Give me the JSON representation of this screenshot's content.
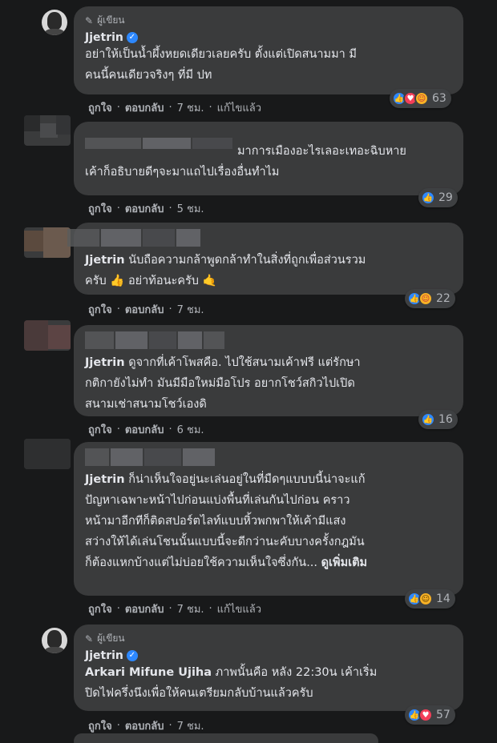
{
  "comments": [
    {
      "is_author": true,
      "author_badge": "ผู้เขียน",
      "name": "Jjetrin",
      "lines": [
        "อย่าให้เป็นน้ำผึ้งหยดเดียวเลยครับ ตั้งแต่เปิดสนามมา มี",
        "คนนี้คนเดียวจริงๆ ที่มี ปท"
      ],
      "actions": {
        "like": "ถูกใจ",
        "reply": "ตอบกลับ",
        "time": "7 ชม.",
        "edited": "แก้ไขแล้ว"
      },
      "reactions": [
        "like-icon",
        "love-icon",
        "care-icon"
      ],
      "reaction_count": "63"
    },
    {
      "is_author": false,
      "lines": [
        "มาการเมืองอะไรเลอะเทอะฉิบหาย",
        "เค้าก็อธิบายดีๆจะมาแถไปเรื่องอื่นทำไม"
      ],
      "actions": {
        "like": "ถูกใจ",
        "reply": "ตอบกลับ",
        "time": "5 ชม."
      },
      "reactions": [
        "like-icon"
      ],
      "reaction_count": "29"
    },
    {
      "is_author": false,
      "mention": "Jjetrin",
      "lines": [
        "นับถือความกล้าพูดกล้าทำในสิ่งที่ถูกเพื่อส่วนรวม",
        "ครับ 👍 อย่าท้อนะครับ 🤙"
      ],
      "actions": {
        "like": "ถูกใจ",
        "reply": "ตอบกลับ",
        "time": "7 ชม."
      },
      "reactions": [
        "like-icon",
        "care-icon"
      ],
      "reaction_count": "22"
    },
    {
      "is_author": false,
      "mention": "Jjetrin",
      "lines": [
        "ดูจากที่เค้าโพสคือ. ไปใช้สนามเค้าฟรี แต่รักษา",
        "กติกายังไม่ทำ มันมีมือใหม่มือโปร อยากโชว์สกิวไปเปิด",
        "สนามเช่าสนามโชว์เองดิ"
      ],
      "actions": {
        "like": "ถูกใจ",
        "reply": "ตอบกลับ",
        "time": "6 ชม."
      },
      "reactions": [
        "like-icon"
      ],
      "reaction_count": "16"
    },
    {
      "is_author": false,
      "mention": "Jjetrin",
      "lines": [
        "ก็น่าเห็นใจอยู่นะเล่นอยู่ในที่มืดๆแบบบนี้น่าจะแก้",
        "ปัญหาเฉพาะหน้าไปก่อนแบ่งพื้นที่เล่นกันไปก่อน คราว",
        "หน้ามาอีกทีก็ติดสปอร์ตไลท์แบบหิ้วพกพาให้เค้ามีแสง",
        "สว่างให้ได้เล่นโชนนั้นแบบนี้จะดีกว่านะคับบางครั้งกฎมัน",
        "ก็ต้องแหกบ้างแต่ไม่บ่อยใช้ความเห็นใจซึ่งกัน..."
      ],
      "see_more": "ดูเพิ่มเติม",
      "actions": {
        "like": "ถูกใจ",
        "reply": "ตอบกลับ",
        "time": "7 ชม.",
        "edited": "แก้ไขแล้ว"
      },
      "reactions": [
        "like-icon",
        "haha-icon"
      ],
      "reaction_count": "14"
    },
    {
      "is_author": true,
      "author_badge": "ผู้เขียน",
      "name": "Jjetrin",
      "mention": "Arkari Mifune Ujiha",
      "lines": [
        "ภาพนั้นคือ หลัง 22:30น เค้าเริ่ม",
        "ปิดไฟครึ่งนึงเพื่อให้คนเตรียมกลับบ้านแล้วครับ"
      ],
      "actions": {
        "like": "ถูกใจ",
        "reply": "ตอบกลับ",
        "time": "7 ชม."
      },
      "reactions": [
        "like-icon",
        "love-icon"
      ],
      "reaction_count": "57"
    }
  ]
}
